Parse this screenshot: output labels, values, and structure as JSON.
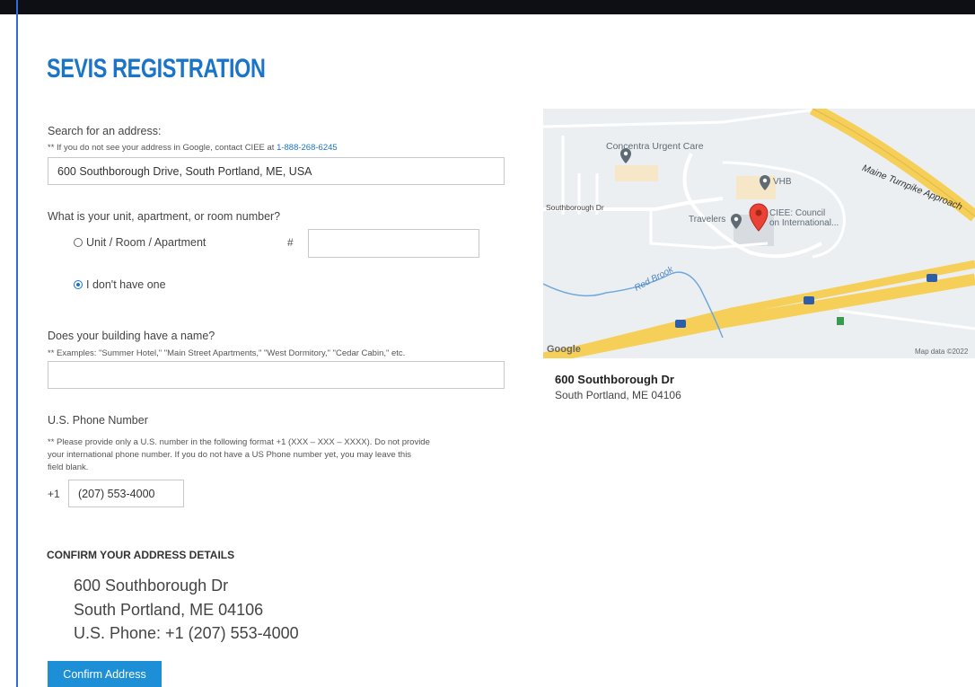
{
  "page": {
    "title": "SEVIS REGISTRATION"
  },
  "search": {
    "label": "Search for an address:",
    "note_prefix": "** If you do not see your address in Google, contact CIEE at ",
    "note_phone": "1-888-268-6245",
    "value": "600 Southborough Drive, South Portland, ME, USA"
  },
  "unit": {
    "question": "What is your unit, apartment, or room number?",
    "option_unit": "Unit / Room / Apartment",
    "hash": "#",
    "unit_value": "",
    "option_none": "I don't have one",
    "selected": "none"
  },
  "building": {
    "question": "Does your building have a name?",
    "note": "** Examples: \"Summer Hotel,\" \"Main Street Apartments,\" \"West Dormitory,\" \"Cedar Cabin,\" etc.",
    "value": ""
  },
  "phone": {
    "label": "U.S. Phone Number",
    "note_line1": "** Please provide only a U.S. number in the following format +1 (XXX – XXX – XXXX). Do not provide",
    "note_line2": "your international phone number. If you do not have a US Phone number yet, you may leave this",
    "note_line3": "field blank.",
    "prefix": "+1",
    "value": "(207) 553-4000"
  },
  "confirm": {
    "heading": "CONFIRM YOUR ADDRESS DETAILS",
    "line1": "600 Southborough Dr",
    "line2": "South Portland, ME 04106",
    "line3": "U.S. Phone: +1 (207) 553-4000",
    "button": "Confirm Address"
  },
  "map": {
    "label_concentra": "Concentra Urgent Care",
    "label_vhb": "VHB",
    "label_southborough": "Southborough Dr",
    "label_travelers": "Travelers",
    "label_ciee_1": "CIEE: Council",
    "label_ciee_2": "on International...",
    "label_turnpike": "Maine Turnpike Approach",
    "label_brook": "Red Brook",
    "shield_295": "295",
    "exit_1": "1",
    "google": "Google",
    "map_data": "Map data ©2022",
    "colors": {
      "highway": "#f5cf58",
      "water": "#6fa8dc",
      "marker": "#ea4335",
      "poi": "#5f6b74"
    }
  },
  "place": {
    "name": "600 Southborough Dr",
    "address": "South Portland, ME 04106"
  }
}
